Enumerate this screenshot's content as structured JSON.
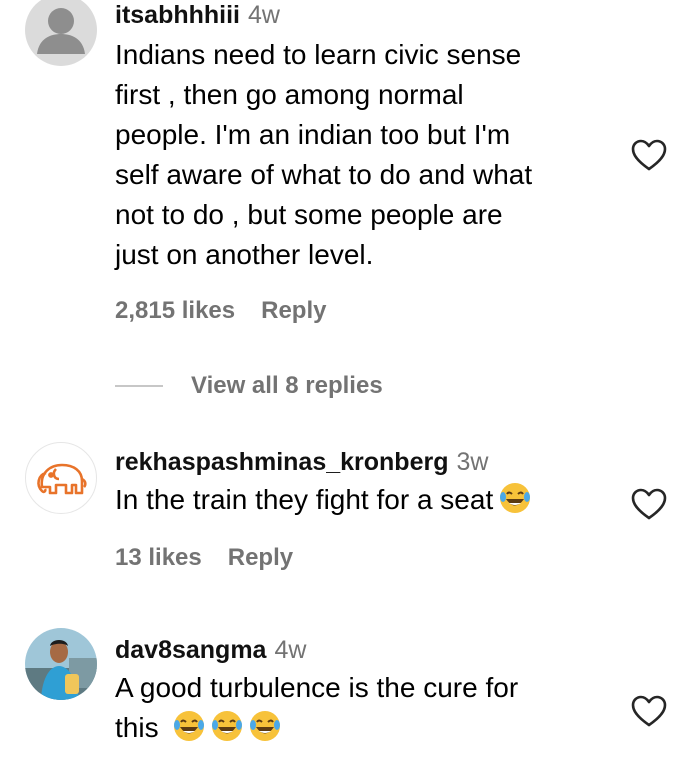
{
  "comments": [
    {
      "username": "itsabhhhiii",
      "time": "4w",
      "text": "Indians need to learn civic sense first , then go among normal people. I'm an indian too but I'm self aware of what to do and what not to do , but some people are just on another level.",
      "text_lines": [
        "Indians need to learn civic sense",
        "first , then go among normal",
        "people. I'm an indian too but I'm",
        "self aware of what to do and what",
        "not to do , but some people are",
        "just on another level."
      ],
      "likes": "2,815 likes",
      "reply_label": "Reply",
      "view_replies": "View all 8 replies",
      "avatar": "default-profile-icon"
    },
    {
      "username": "rekhaspashminas_kronberg",
      "time": "3w",
      "text": "In the train they fight for a seat",
      "likes": "13 likes",
      "reply_label": "Reply",
      "avatar": "elephant-logo-icon",
      "emoji": "face-with-tears-of-joy"
    },
    {
      "username": "dav8sangma",
      "time": "4w",
      "text_line1": "A good turbulence is the cure for",
      "text_line2": "this",
      "avatar": "user-photo",
      "emoji": "face-with-tears-of-joy",
      "emoji_count": 3
    }
  ],
  "colors": {
    "secondary": "#737373",
    "text": "#000000",
    "accent": "#e8732a"
  }
}
